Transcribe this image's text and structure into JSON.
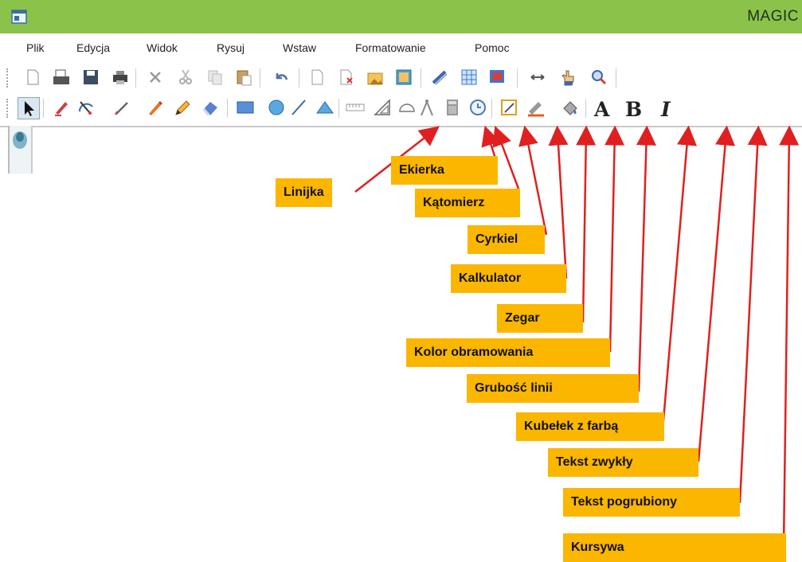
{
  "window": {
    "title": "MAGIC"
  },
  "menu": [
    "Plik",
    "Edycja",
    "Widok",
    "Rysuj",
    "Wstaw",
    "Formatowanie",
    "Pomoc"
  ],
  "toolbar1_icons": [
    "new-document-icon",
    "open-icon",
    "save-icon",
    "print-icon",
    "delete-icon",
    "cut-icon",
    "copy-icon",
    "paste-icon",
    "undo-icon",
    "blank-page-icon",
    "page-remove-icon",
    "insert-image-icon",
    "picture-icon",
    "line-style-icon",
    "grid-icon",
    "screen-icon",
    "arrows-icon",
    "hand-icon",
    "zoom-icon"
  ],
  "toolbar2_icons": [
    "pointer-icon",
    "marker-icon",
    "protractor-tool-icon",
    "pen-icon",
    "highlighter-icon",
    "pencil-icon",
    "eraser-icon",
    "rectangle-icon",
    "ellipse-icon",
    "line-icon",
    "triangle-icon",
    "ruler-icon",
    "set-square-icon",
    "protractor-icon",
    "compass-icon",
    "calculator-icon",
    "clock-icon",
    "border-color-icon",
    "line-width-icon",
    "paint-bucket-icon"
  ],
  "text_buttons": {
    "normal": "A",
    "bold": "B",
    "italic": "I"
  },
  "labels": {
    "ruler": "Linijka",
    "set_square": "Ekierka",
    "protractor": "Kątomierz",
    "compass": "Cyrkiel",
    "calculator": "Kalkulator",
    "clock": "Zegar",
    "border_color": "Kolor obramowania",
    "line_width": "Grubość linii",
    "paint_bucket": "Kubełek z farbą",
    "text_normal": "Tekst zwykły",
    "text_bold": "Tekst pogrubiony",
    "italic": "Kursywa"
  },
  "colors": {
    "titlebar": "#8bc34a",
    "label_bg": "#fbb600",
    "arrow": "#e02020"
  }
}
